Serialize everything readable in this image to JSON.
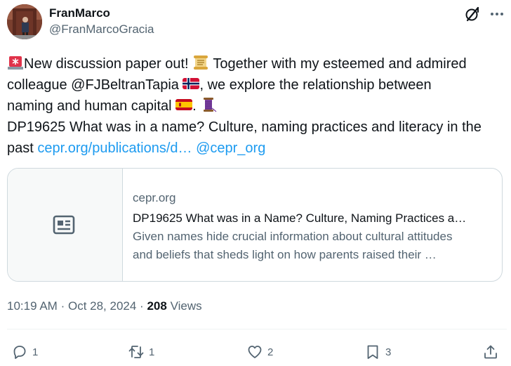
{
  "author": {
    "display_name": "FranMarco",
    "handle": "@FranMarcoGracia"
  },
  "post": {
    "line1_a": "New discussion paper out!",
    "line1_b": "Together with my esteemed and admired",
    "line2_a": "colleague @FJBeltranTapia",
    "line2_b": ", we explore the relationship between",
    "line3": "naming and human capital",
    "line3_b": ".",
    "line4": "DP19625 What was in a name? Culture, naming practices and literacy in the",
    "line5": "past",
    "link_url": "cepr.org/publications/d…",
    "link_mention": "@cepr_org",
    "emojis": [
      "rotating-light",
      "scroll",
      "flag-norway",
      "flag-spain",
      "thread-spool"
    ]
  },
  "card": {
    "domain": "cepr.org",
    "title": "DP19625 What was in a Name? Culture, Naming Practices a…",
    "description_line1": "Given names hide crucial information about cultural attitudes",
    "description_line2": "and beliefs that sheds light on how parents raised their …"
  },
  "meta": {
    "time": "10:19 AM",
    "sep": "·",
    "date": "Oct 28, 2024",
    "views_count": "208",
    "views_label": "Views"
  },
  "actions": {
    "replies": "1",
    "reposts": "1",
    "likes": "2",
    "bookmarks": "3"
  },
  "colors": {
    "link": "#1d9bf0",
    "secondary_text": "#536471",
    "border": "#cfd9de"
  }
}
